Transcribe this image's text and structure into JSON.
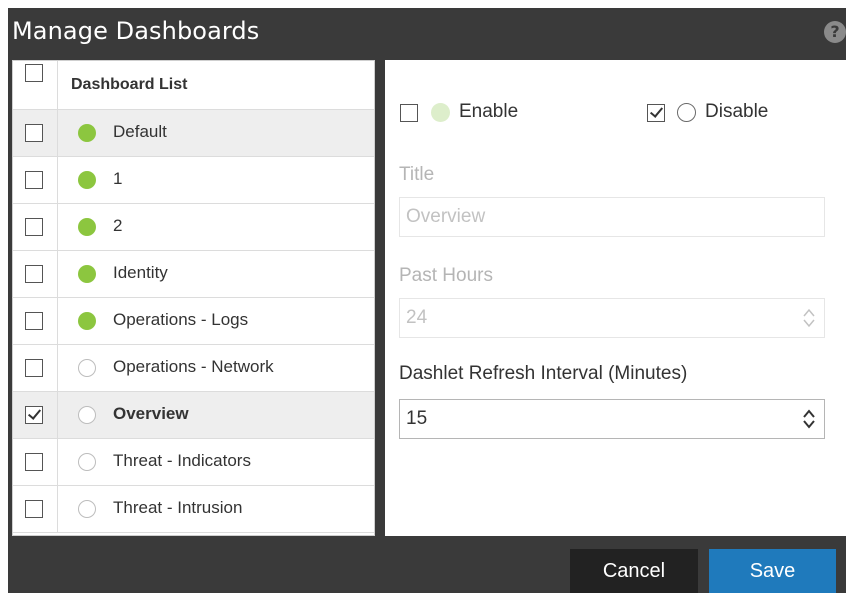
{
  "dialog": {
    "title": "Manage Dashboards",
    "help_icon": "question-circle-icon",
    "help_glyph": "?"
  },
  "dashboard_list": {
    "header": "Dashboard List",
    "items": [
      {
        "label": "Default",
        "enabled": true,
        "checked": false
      },
      {
        "label": "1",
        "enabled": true,
        "checked": false
      },
      {
        "label": "2",
        "enabled": true,
        "checked": false
      },
      {
        "label": "Identity",
        "enabled": true,
        "checked": false
      },
      {
        "label": "Operations - Logs",
        "enabled": true,
        "checked": false
      },
      {
        "label": "Operations - Network",
        "enabled": false,
        "checked": false
      },
      {
        "label": "Overview",
        "enabled": false,
        "checked": true
      },
      {
        "label": "Threat - Indicators",
        "enabled": false,
        "checked": false
      },
      {
        "label": "Threat - Intrusion",
        "enabled": false,
        "checked": false
      }
    ]
  },
  "form": {
    "enable_label": "Enable",
    "enable_checked": false,
    "disable_label": "Disable",
    "disable_checked": true,
    "title_label": "Title",
    "title_value": "Overview",
    "past_hours_label": "Past Hours",
    "past_hours_value": "24",
    "refresh_label": "Dashlet Refresh Interval (Minutes)",
    "refresh_value": "15"
  },
  "buttons": {
    "cancel": "Cancel",
    "save": "Save"
  },
  "colors": {
    "enabled_dot": "#8cc63f",
    "save_button": "#1f7abc",
    "dialog_bg": "#3a3a3a"
  }
}
